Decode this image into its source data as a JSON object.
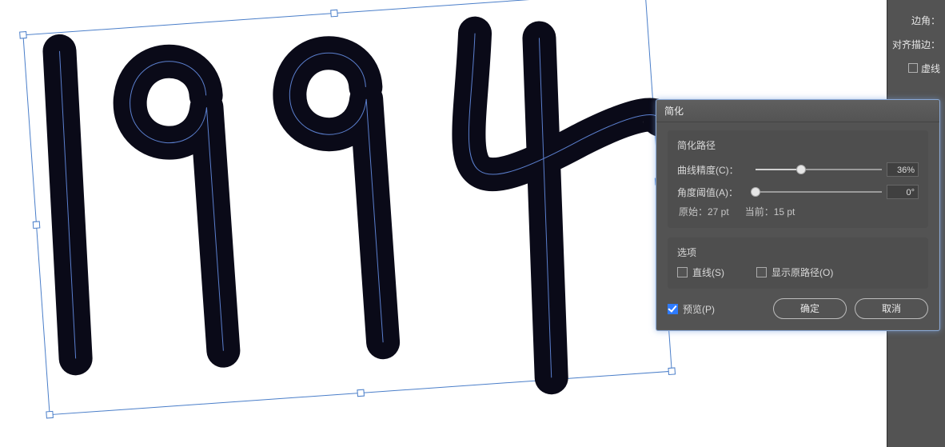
{
  "right_panel": {
    "corner_label": "边角：",
    "align_stroke_label": "对齐描边：",
    "dashed_label": "虚线"
  },
  "dialog": {
    "title": "简化",
    "group_simplify": {
      "title": "简化路径",
      "curve_precision_label": "曲线精度(C)：",
      "curve_precision_value": "36%",
      "curve_precision_percent": 36,
      "angle_threshold_label": "角度阈值(A)：",
      "angle_threshold_value": "0°",
      "angle_threshold_percent": 0,
      "status_original": "原始：27 pt",
      "status_current": "当前：15 pt"
    },
    "group_options": {
      "title": "选项",
      "straight_lines_label": "直线(S)",
      "show_original_label": "显示原路径(O)"
    },
    "preview_label": "预览(P)",
    "ok_label": "确定",
    "cancel_label": "取消"
  }
}
